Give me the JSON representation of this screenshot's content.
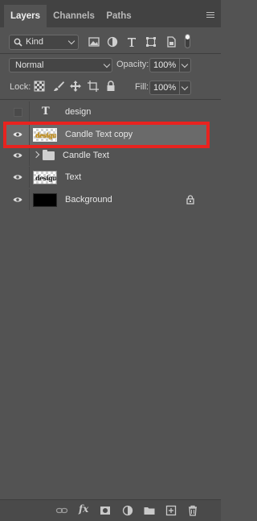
{
  "tabs": [
    {
      "label": "Layers",
      "active": true
    },
    {
      "label": "Channels",
      "active": false
    },
    {
      "label": "Paths",
      "active": false
    }
  ],
  "filter": {
    "kind_label": "Kind",
    "icons": [
      "pixel-filter-icon",
      "adjustment-filter-icon",
      "type-filter-icon",
      "shape-filter-icon",
      "smart-object-filter-icon"
    ]
  },
  "blend": {
    "mode": "Normal",
    "opacity_label": "Opacity:",
    "opacity_value": "100%"
  },
  "lock": {
    "label": "Lock:",
    "fill_label": "Fill:",
    "fill_value": "100%"
  },
  "layers": [
    {
      "name": "design",
      "visible": false,
      "type": "text",
      "selected": false
    },
    {
      "name": "Candle Text copy",
      "visible": true,
      "type": "pixel",
      "thumb_text": "design",
      "selected": true
    },
    {
      "name": "Candle Text",
      "visible": true,
      "type": "group",
      "selected": false
    },
    {
      "name": "Text",
      "visible": true,
      "type": "pixel",
      "thumb_text": "design",
      "selected": false
    },
    {
      "name": "Background",
      "visible": true,
      "type": "background",
      "locked": true,
      "selected": false
    }
  ],
  "colors": {
    "panel_bg": "#535353",
    "selected_row": "#6a6a6a",
    "highlight_border": "#e8231f"
  },
  "bottom_toolbar": [
    "link-icon",
    "fx-icon",
    "mask-icon",
    "adjustment-icon",
    "group-folder-icon",
    "new-layer-icon",
    "trash-icon"
  ]
}
